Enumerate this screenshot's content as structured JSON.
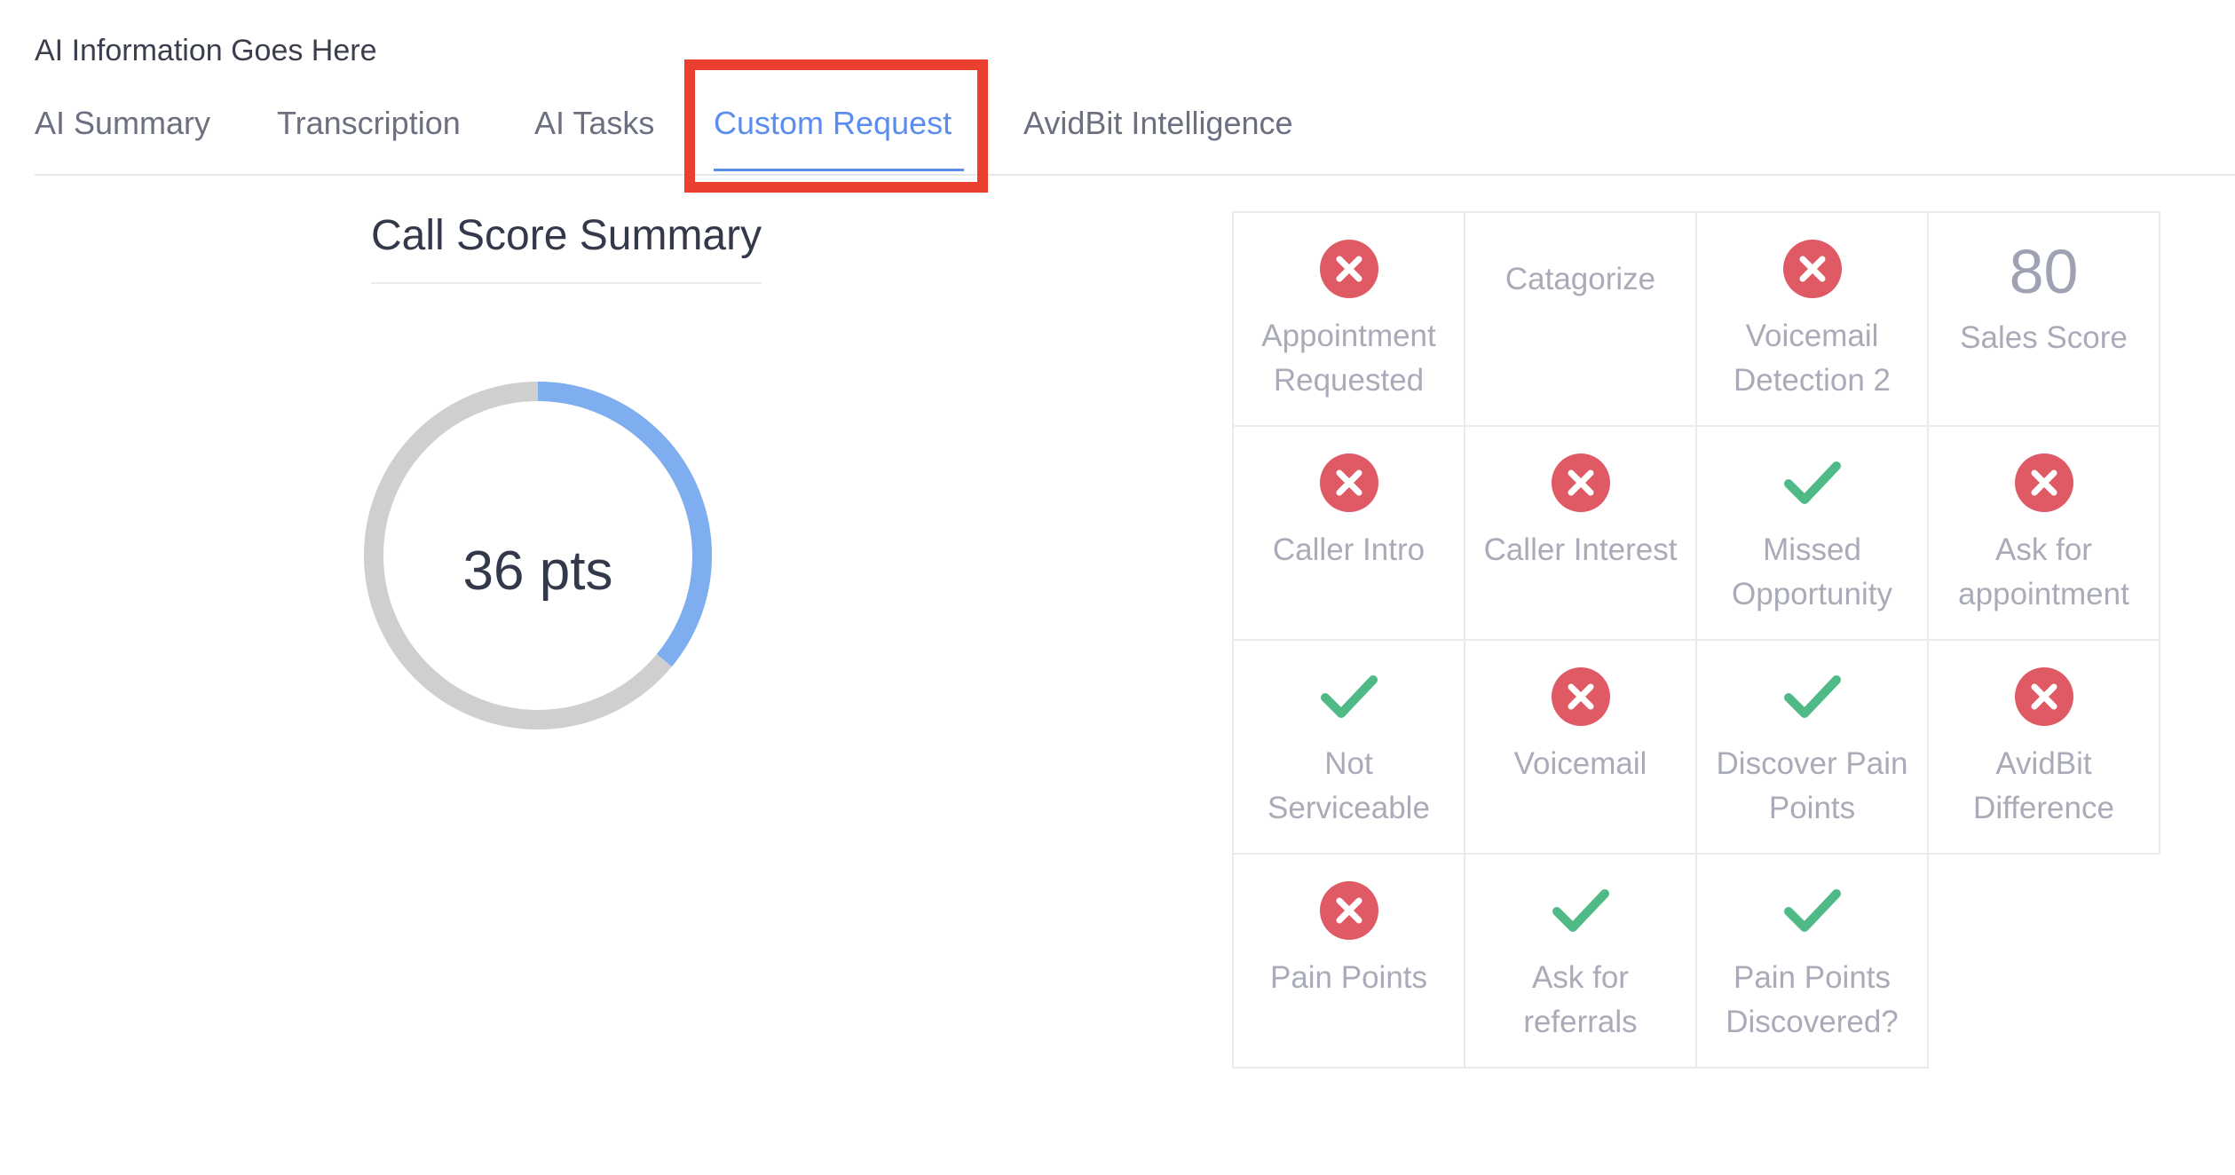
{
  "page": {
    "heading": "AI Information Goes Here"
  },
  "tabs": [
    {
      "label": "AI Summary"
    },
    {
      "label": "Transcription"
    },
    {
      "label": "AI Tasks"
    },
    {
      "label": "Custom Request"
    },
    {
      "label": "AvidBit Intelligence"
    }
  ],
  "active_tab": "Custom Request",
  "score": {
    "title": "Call Score Summary",
    "value_text": "36 pts",
    "progress_fraction": 0.36,
    "ring_color": "#7eaef0",
    "track_color": "#cfcfcf"
  },
  "colors": {
    "accent": "#5b8def",
    "fail": "#e05a66",
    "pass": "#4fba86",
    "highlight": "#ea3f2e"
  },
  "grid": {
    "cells": [
      {
        "label": "Appointment Requested",
        "status": "fail",
        "icon": "x-circle-icon"
      },
      {
        "label": "Catagorize",
        "status": "none",
        "icon": ""
      },
      {
        "label": "Voicemail Detection 2",
        "status": "fail",
        "icon": "x-circle-icon"
      },
      {
        "label": "Sales Score",
        "status": "score",
        "value": "80"
      },
      {
        "label": "Caller Intro",
        "status": "fail",
        "icon": "x-circle-icon"
      },
      {
        "label": "Caller Interest",
        "status": "fail",
        "icon": "x-circle-icon"
      },
      {
        "label": "Missed Opportunity",
        "status": "pass",
        "icon": "checkmark-icon"
      },
      {
        "label": "Ask for appointment",
        "status": "fail",
        "icon": "x-circle-icon"
      },
      {
        "label": "Not Serviceable",
        "status": "pass",
        "icon": "checkmark-icon"
      },
      {
        "label": "Voicemail",
        "status": "fail",
        "icon": "x-circle-icon"
      },
      {
        "label": "Discover Pain Points",
        "status": "pass",
        "icon": "checkmark-icon"
      },
      {
        "label": "AvidBit Difference",
        "status": "fail",
        "icon": "x-circle-icon"
      },
      {
        "label": "Pain Points",
        "status": "fail",
        "icon": "x-circle-icon"
      },
      {
        "label": "Ask for referrals",
        "status": "pass",
        "icon": "checkmark-icon"
      },
      {
        "label": "Pain Points Discovered?",
        "status": "pass",
        "icon": "checkmark-icon"
      }
    ]
  }
}
